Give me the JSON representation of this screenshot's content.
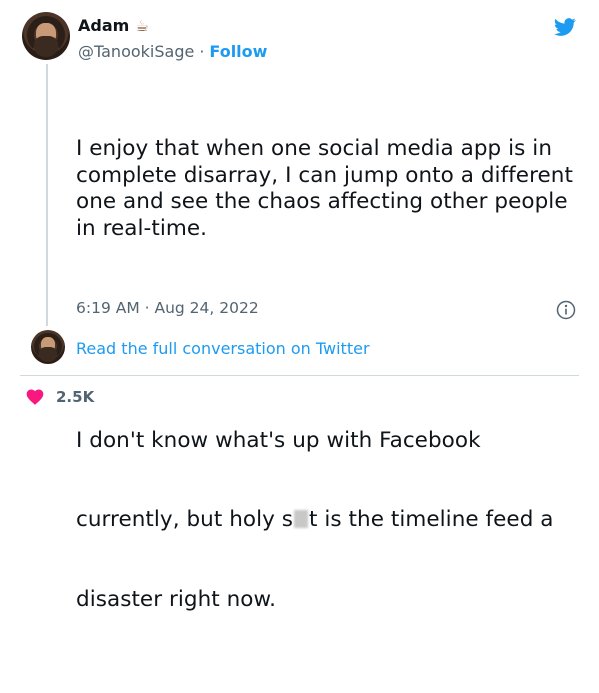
{
  "author": {
    "name": "Adam",
    "name_emoji": "☕",
    "handle": "@TanookiSage",
    "separator": "·",
    "follow_label": "Follow"
  },
  "tweet": {
    "para1": "I enjoy that when one social media app is in\ncomplete disarray, I can jump onto a different\none and see the chaos affecting other people\nin real-time.",
    "para2_line1": "I don't know what's up with Facebook",
    "para2_line2_a": "currently, but holy s",
    "para2_line2_b": "t is the timeline feed a",
    "para2_line3": "disaster right now.",
    "timestamp": "6:19 AM · Aug 24, 2022"
  },
  "conversation": {
    "link_label": "Read the full conversation on Twitter"
  },
  "engagement": {
    "likes": "2.5K"
  },
  "icons": {
    "brand": "twitter-bird-icon",
    "info": "info-icon",
    "like": "heart-icon"
  },
  "colors": {
    "accent": "#1d9bf0",
    "like": "#f91880",
    "muted": "#536471"
  }
}
